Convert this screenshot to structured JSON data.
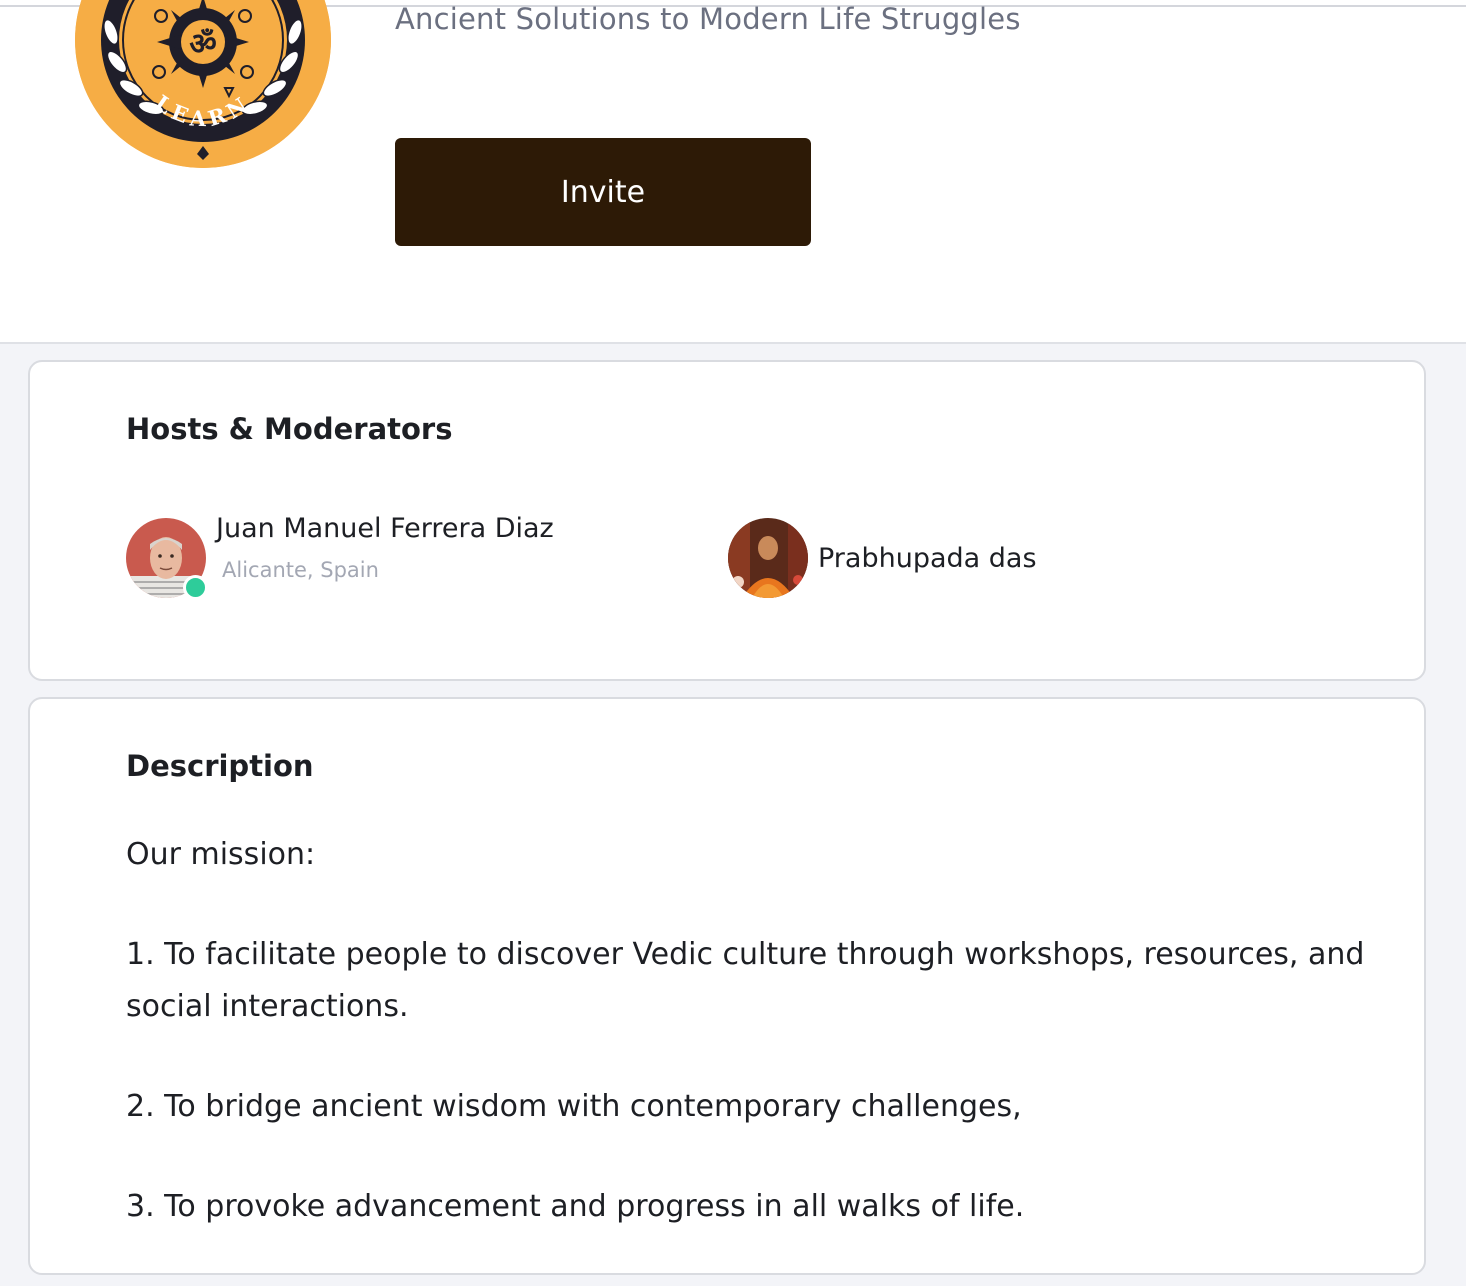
{
  "header": {
    "subtitle": "Ancient Solutions to Modern Life Struggles",
    "invite_label": "Invite",
    "logo_text": "LEARN",
    "logo_symbol": "ॐ"
  },
  "hosts": {
    "title": "Hosts & Moderators",
    "people": [
      {
        "name": "Juan Manuel Ferrera Diaz",
        "location": "Alicante, Spain",
        "online": true
      },
      {
        "name": "Prabhupada das",
        "location": "",
        "online": false
      }
    ]
  },
  "description": {
    "title": "Description",
    "intro": "Our mission:",
    "items": [
      "1. To facilitate people to discover Vedic culture through workshops, resources, and social interactions.",
      "2. To bridge ancient wisdom with contemporary challenges,",
      "3. To provoke advancement and progress in all walks of life."
    ]
  },
  "colors": {
    "accent_button": "#2d1a06",
    "logo_orange": "#f6ad45",
    "online_green": "#2ecc9a",
    "page_bg": "#f3f4f8"
  }
}
